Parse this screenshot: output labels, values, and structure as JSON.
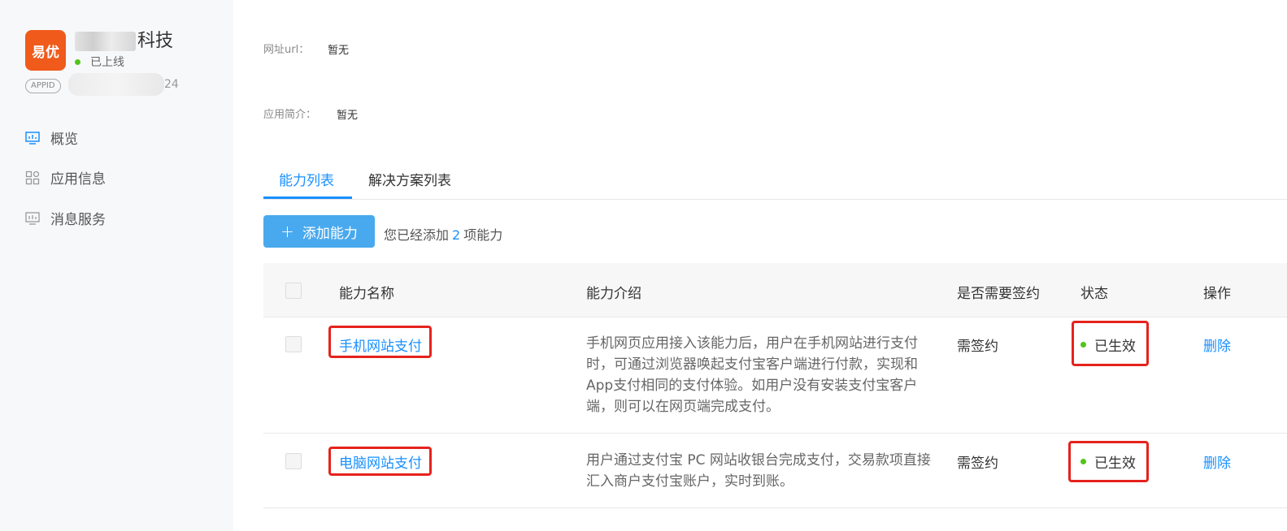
{
  "app": {
    "logo_text": "易优",
    "name_suffix": "科技",
    "status": "已上线",
    "appid_label": "APPID",
    "appid_tail": "24"
  },
  "sidebar": {
    "items": [
      {
        "label": "概览",
        "icon": "dashboard-icon"
      },
      {
        "label": "应用信息",
        "icon": "grid-icon"
      },
      {
        "label": "消息服务",
        "icon": "message-chart-icon"
      }
    ]
  },
  "fields": {
    "url_label": "网址url：",
    "url_value": "暂无",
    "intro_label": "应用简介：",
    "intro_value": "暂无"
  },
  "tabs": [
    {
      "label": "能力列表",
      "active": true
    },
    {
      "label": "解决方案列表",
      "active": false
    }
  ],
  "toolbar": {
    "add_plus": "+",
    "add_label": "添加能力",
    "count_prefix": "您已经添加",
    "count": "2",
    "count_suffix": "项能力"
  },
  "table": {
    "headers": [
      "能力名称",
      "能力介绍",
      "是否需要签约",
      "状态",
      "操作"
    ],
    "rows": [
      {
        "name": "手机网站支付",
        "desc": "手机网页应用接入该能力后，用户在手机网站进行支付时，可通过浏览器唤起支付宝客户端进行付款，实现和App支付相同的支付体验。如用户没有安装支付宝客户端，则可以在网页端完成支付。",
        "sign": "需签约",
        "status": "已生效",
        "action": "删除"
      },
      {
        "name": "电脑网站支付",
        "desc": "用户通过支付宝 PC 网站收银台完成支付，交易款项直接汇入商户支付宝账户，实时到账。",
        "sign": "需签约",
        "status": "已生效",
        "action": "删除"
      }
    ]
  },
  "colors": {
    "accent": "#1890ff",
    "button": "#49a9ee",
    "success": "#52c41a",
    "highlight": "#e5231c",
    "logo": "#f05a1a"
  }
}
